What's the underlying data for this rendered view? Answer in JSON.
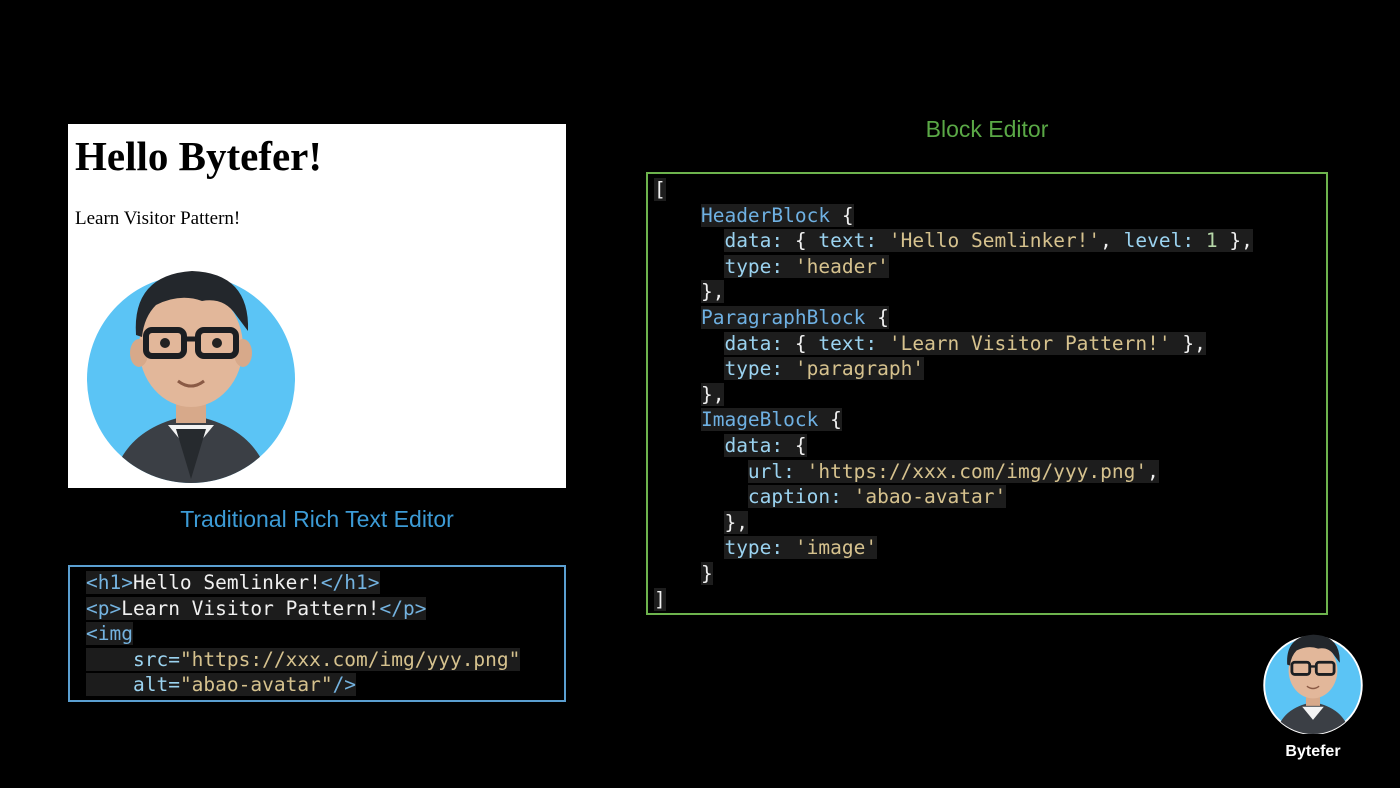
{
  "preview": {
    "heading": "Hello Bytefer!",
    "paragraph": "Learn Visitor Pattern!"
  },
  "captions": {
    "traditional": "Traditional Rich Text Editor",
    "block": "Block Editor"
  },
  "html_code": {
    "line1": {
      "open": "<h1>",
      "text": "Hello Semlinker!",
      "close": "</h1>"
    },
    "line2": {
      "open": "<p>",
      "text": "Learn Visitor Pattern!",
      "close": "</p>"
    },
    "line3": {
      "open": "<img"
    },
    "line4": {
      "attr": "src=",
      "value": "\"https://xxx.com/img/yyy.png\""
    },
    "line5": {
      "attr": "alt=",
      "value": "\"abao-avatar\"",
      "close": "/>"
    }
  },
  "json_code": {
    "open_bracket": "[",
    "header_block": "HeaderBlock",
    "header_data_key": "data:",
    "header_data_open": "{ ",
    "header_text_key": "text:",
    "header_text_value": "'Hello Semlinker!'",
    "header_level_key": "level:",
    "header_level_value": "1",
    "header_data_close": " },",
    "header_type_key": "type:",
    "header_type_value": "'header'",
    "block_close_comma": "},",
    "paragraph_block": "ParagraphBlock",
    "paragraph_text_value": "'Learn Visitor Pattern!'",
    "paragraph_type_value": "'paragraph'",
    "image_block": "ImageBlock",
    "image_url_key": "url:",
    "image_url_value": "'https://xxx.com/img/yyy.png'",
    "image_caption_key": "caption:",
    "image_caption_value": "'abao-avatar'",
    "image_type_value": "'image'",
    "close_brace": "}",
    "close_bracket": "]"
  },
  "brand": {
    "name": "Bytefer"
  },
  "colors": {
    "traditional_accent": "#3c9bd6",
    "block_accent": "#5aa846",
    "background": "#000000"
  }
}
